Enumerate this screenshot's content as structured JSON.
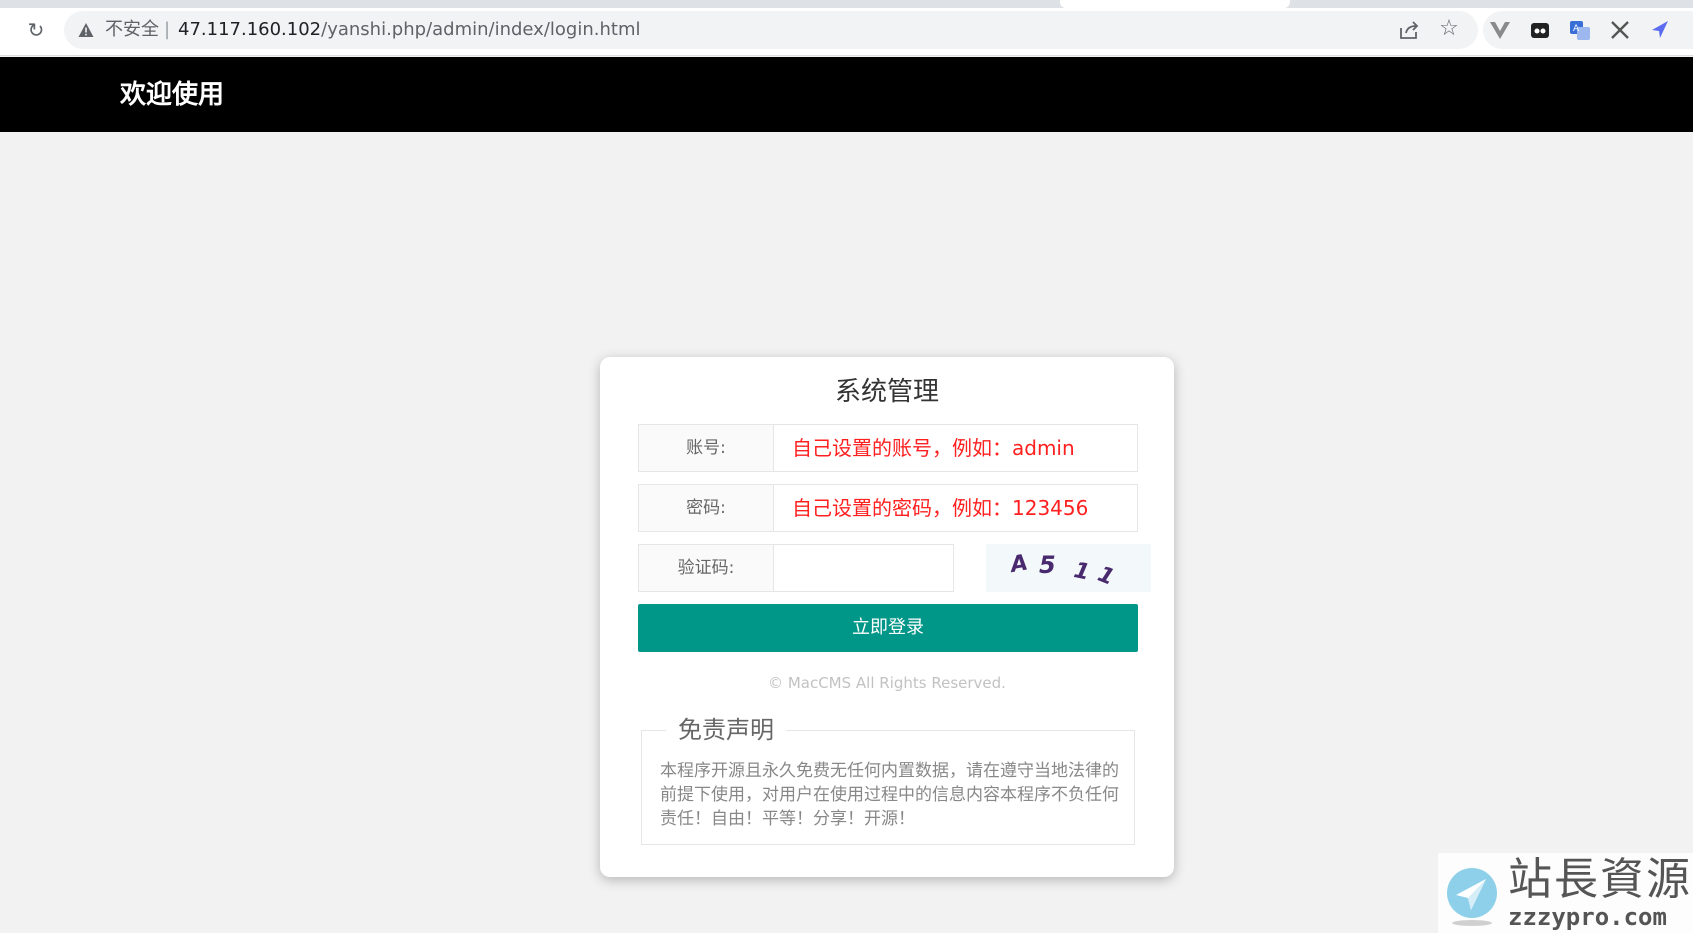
{
  "browser": {
    "not_secure_label": "不安全",
    "separator": "|",
    "url_host": "47.117.160.102",
    "url_path": "/yanshi.php/admin/index/login.html",
    "icons": [
      "reload-icon",
      "warning-icon",
      "share-icon",
      "star-icon",
      "vue-devtools-icon",
      "extension-icon",
      "translate-icon",
      "x-extension-icon",
      "arrow-extension-icon"
    ]
  },
  "header": {
    "title": "欢迎使用",
    "background": "#000000"
  },
  "login": {
    "title": "系统管理",
    "account_label": "账号:",
    "account_value": "自己设置的账号，例如：admin",
    "password_label": "密码:",
    "password_value": "自己设置的密码，例如：123456",
    "captcha_label": "验证码:",
    "captcha_value": "",
    "captcha_text": "A511",
    "submit_label": "立即登录",
    "accent_color": "#009688",
    "input_text_color": "#ff2020"
  },
  "footer": {
    "copyright": "© MacCMS All Rights Reserved."
  },
  "disclaimer": {
    "title": "免责声明",
    "text": "本程序开源且永久免费无任何内置数据，请在遵守当地法律的前提下使用，对用户在使用过程中的信息内容本程序不负任何责任！自由！平等！分享！开源！"
  },
  "watermark": {
    "cn": "站長資源",
    "en": "zzzypro.com"
  }
}
